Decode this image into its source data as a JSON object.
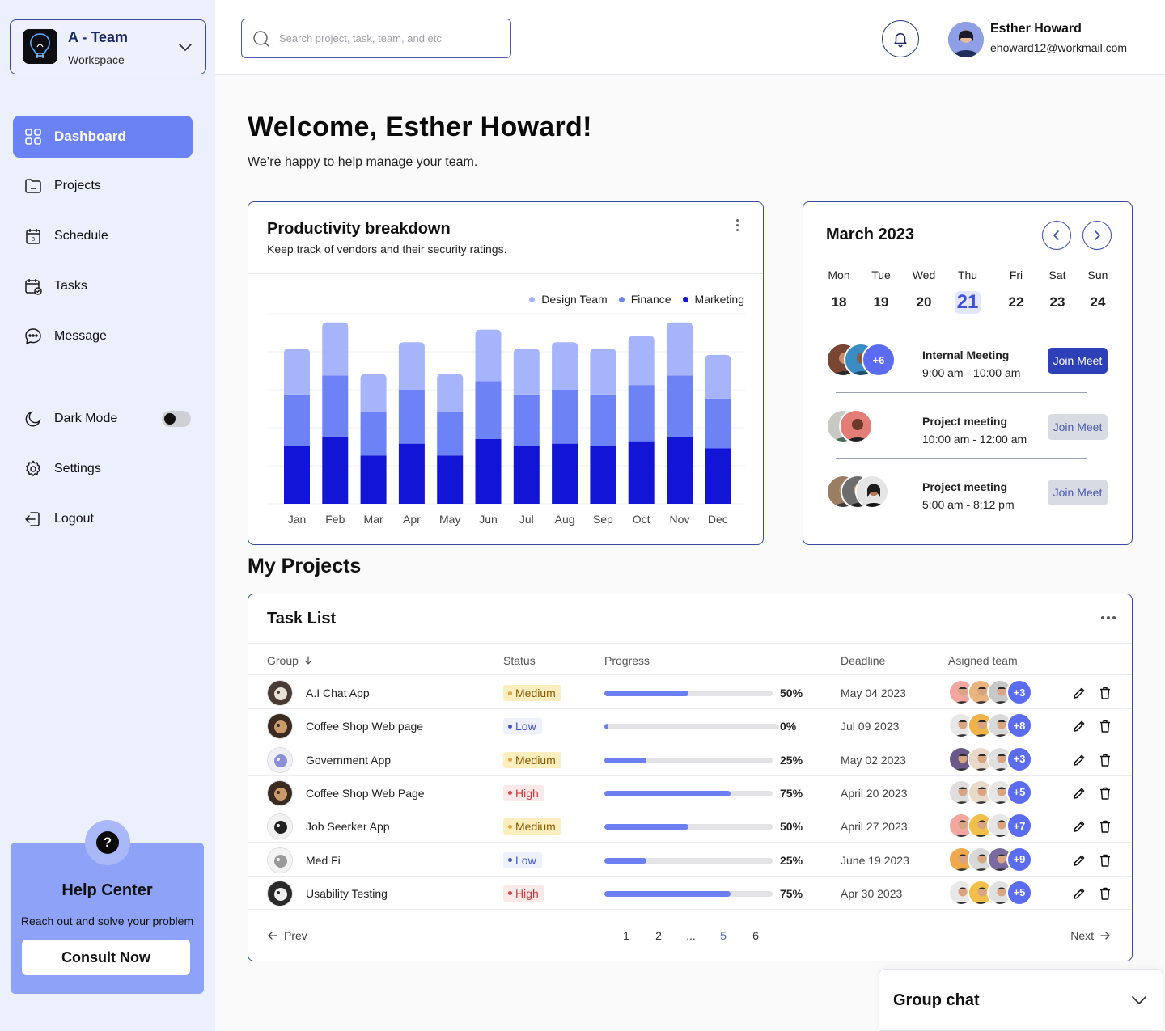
{
  "workspace": {
    "name": "A - Team",
    "sub": "Workspace"
  },
  "nav": {
    "dashboard": "Dashboard",
    "projects": "Projects",
    "schedule": "Schedule",
    "tasks": "Tasks",
    "message": "Message",
    "dark_mode": "Dark Mode",
    "settings": "Settings",
    "logout": "Logout"
  },
  "dark_mode_on": false,
  "help": {
    "icon": "?",
    "title": "Help Center",
    "sub": "Reach out and solve your problem",
    "button": "Consult Now"
  },
  "search": {
    "placeholder": "Search project, task, team, and etc",
    "value": ""
  },
  "user": {
    "name": "Esther Howard",
    "email": "ehoward12@workmail.com"
  },
  "welcome": {
    "title": "Welcome, Esther Howard!",
    "sub": "We’re happy to help manage your team."
  },
  "productivity": {
    "title": "Productivity breakdown",
    "sub": "Keep track of vendors and their security ratings."
  },
  "chart_data": {
    "type": "bar",
    "stacked": true,
    "categories": [
      "Jan",
      "Feb",
      "Mar",
      "Apr",
      "May",
      "Jun",
      "Jul",
      "Aug",
      "Sep",
      "Oct",
      "Nov",
      "Dec"
    ],
    "series": [
      {
        "name": "Marketing",
        "color": "#1215d6",
        "values": [
          73,
          85,
          61,
          76,
          61,
          82,
          73,
          76,
          73,
          79,
          85,
          70
        ]
      },
      {
        "name": "Finance",
        "color": "#6c82f5",
        "values": [
          65,
          77,
          55,
          68,
          55,
          73,
          65,
          68,
          65,
          71,
          77,
          63
        ]
      },
      {
        "name": "Design Team",
        "color": "#a6b5fb",
        "values": [
          58,
          67,
          48,
          60,
          48,
          65,
          58,
          60,
          58,
          62,
          67,
          55
        ]
      }
    ],
    "legend_order": [
      "Design Team",
      "Finance",
      "Marketing"
    ],
    "ylim": [
      0,
      240
    ],
    "grid": true,
    "legend_position": "top-right"
  },
  "calendar": {
    "month": "March 2023",
    "days": [
      {
        "name": "Mon",
        "date": "18"
      },
      {
        "name": "Tue",
        "date": "19"
      },
      {
        "name": "Wed",
        "date": "20"
      },
      {
        "name": "Thu",
        "date": "21"
      },
      {
        "name": "Fri",
        "date": "22"
      },
      {
        "name": "Sat",
        "date": "23"
      },
      {
        "name": "Sun",
        "date": "24"
      }
    ],
    "today": "21",
    "meetings": [
      {
        "title": "Internal Meeting",
        "time": "9:00  am - 10:00 am",
        "button": "Join Meet",
        "more": "+6"
      },
      {
        "title": "Project meeting",
        "time": "10:00 am - 12:00 am",
        "button": "Join Meet"
      },
      {
        "title": "Project meeting",
        "time": "5:00 am - 8:12 pm",
        "button": "Join Meet"
      }
    ]
  },
  "projects": {
    "heading": "My Projects",
    "card_title": "Task List",
    "columns": {
      "group": "Group",
      "status": "Status",
      "progress": "Progress",
      "deadline": "Deadline",
      "team": "Asigned team"
    },
    "rows": [
      {
        "name": "A.I Chat App",
        "status": "Medium",
        "progress": 0.5,
        "pct": "50%",
        "deadline": "May 04 2023",
        "more": "+3"
      },
      {
        "name": "Coffee Shop Web page",
        "status": "Low",
        "progress": 0.0,
        "pct": "0%",
        "deadline": "Jul 09 2023",
        "more": "+8"
      },
      {
        "name": "Government App",
        "status": "Medium",
        "progress": 0.25,
        "pct": "25%",
        "deadline": "May 02 2023",
        "more": "+3"
      },
      {
        "name": "Coffee Shop Web Page",
        "status": "High",
        "progress": 0.75,
        "pct": "75%",
        "deadline": "April 20 2023",
        "more": "+5"
      },
      {
        "name": "Job  Seerker App",
        "status": "Medium",
        "progress": 0.5,
        "pct": "50%",
        "deadline": "April 27 2023",
        "more": "+7"
      },
      {
        "name": "Med Fi",
        "status": "Low",
        "progress": 0.25,
        "pct": "25%",
        "deadline": "June 19 2023",
        "more": "+9"
      },
      {
        "name": "Usability  Testing",
        "status": "High",
        "progress": 0.75,
        "pct": "75%",
        "deadline": "Apr 30 2023",
        "more": "+5"
      }
    ],
    "pagination": {
      "prev": "Prev",
      "next": "Next",
      "pages": [
        "1",
        "2",
        "...",
        "5",
        "6"
      ],
      "current": "5"
    }
  },
  "group_chat": {
    "title": "Group chat"
  },
  "icons": {
    "search": "search-icon",
    "bell": "bell-icon",
    "dashboard": "grid-icon",
    "projects": "folder-icon",
    "schedule": "calendar-icon",
    "tasks": "calendar-check-icon",
    "message": "chat-icon",
    "dark_mode": "moon-icon",
    "settings": "gear-icon",
    "logout": "logout-icon",
    "edit": "pencil-icon",
    "delete": "trash-icon"
  },
  "colors": {
    "accent": "#6b82f4",
    "primary_button": "#2d40b8",
    "sidebar_bg": "#ecf0fd"
  }
}
